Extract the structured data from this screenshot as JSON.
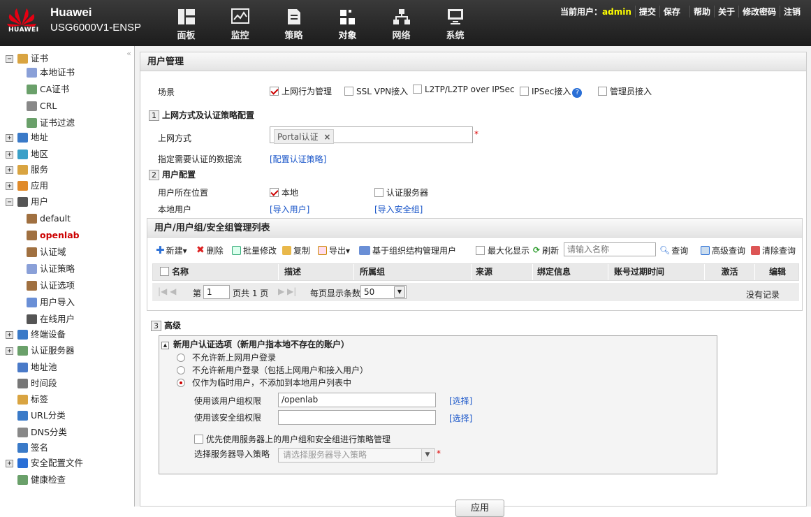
{
  "header": {
    "brand": "Huawei",
    "model": "USG6000V1-ENSP",
    "logo_text": "HUAWEI",
    "nav": [
      {
        "label": "面板",
        "icon": "dashboard-icon"
      },
      {
        "label": "监控",
        "icon": "monitor-icon"
      },
      {
        "label": "策略",
        "icon": "policy-icon"
      },
      {
        "label": "对象",
        "icon": "object-icon"
      },
      {
        "label": "网络",
        "icon": "network-icon"
      },
      {
        "label": "系统",
        "icon": "system-icon"
      }
    ],
    "current_user_label": "当前用户：",
    "current_user": "admin",
    "actions": [
      "提交",
      "保存",
      "帮助",
      "关于",
      "修改密码",
      "注销"
    ]
  },
  "sidebar": {
    "collapse": "«",
    "items": [
      {
        "label": "证书",
        "toggle": "−",
        "icon": "certificate-icon"
      },
      {
        "label": "本地证书",
        "icon": "local-cert-icon"
      },
      {
        "label": "CA证书",
        "icon": "ca-cert-icon"
      },
      {
        "label": "CRL",
        "icon": "crl-icon"
      },
      {
        "label": "证书过滤",
        "icon": "cert-filter-icon"
      },
      {
        "label": "地址",
        "toggle": "+",
        "icon": "address-icon"
      },
      {
        "label": "地区",
        "toggle": "+",
        "icon": "region-icon"
      },
      {
        "label": "服务",
        "toggle": "+",
        "icon": "service-icon"
      },
      {
        "label": "应用",
        "toggle": "+",
        "icon": "application-icon"
      },
      {
        "label": "用户",
        "toggle": "−",
        "icon": "user-icon"
      },
      {
        "label": "default",
        "icon": "user-group-icon"
      },
      {
        "label": "openlab",
        "icon": "user-group-icon"
      },
      {
        "label": "认证域",
        "icon": "auth-domain-icon"
      },
      {
        "label": "认证策略",
        "icon": "auth-policy-icon"
      },
      {
        "label": "认证选项",
        "icon": "auth-option-icon"
      },
      {
        "label": "用户导入",
        "icon": "user-import-icon"
      },
      {
        "label": "在线用户",
        "icon": "online-user-icon"
      },
      {
        "label": "终端设备",
        "toggle": "+",
        "icon": "terminal-icon"
      },
      {
        "label": "认证服务器",
        "toggle": "+",
        "icon": "auth-server-icon"
      },
      {
        "label": "地址池",
        "icon": "address-pool-icon"
      },
      {
        "label": "时间段",
        "icon": "time-range-icon"
      },
      {
        "label": "标签",
        "icon": "tag-icon"
      },
      {
        "label": "URL分类",
        "icon": "url-category-icon"
      },
      {
        "label": "DNS分类",
        "icon": "dns-category-icon"
      },
      {
        "label": "签名",
        "icon": "signature-icon"
      },
      {
        "label": "安全配置文件",
        "toggle": "+",
        "icon": "security-profile-icon"
      },
      {
        "label": "健康检查",
        "icon": "health-check-icon"
      }
    ]
  },
  "main": {
    "title": "用户管理",
    "scene_label": "场景",
    "scenes": [
      {
        "label": "上网行为管理",
        "checked": true
      },
      {
        "label": "SSL VPN接入",
        "checked": false
      },
      {
        "label": "L2TP/L2TP over IPSec",
        "checked": false
      },
      {
        "label": "IPSec接入",
        "checked": false
      },
      {
        "label": "管理员接入",
        "checked": false
      }
    ],
    "help": "?",
    "sec1": {
      "num": "1",
      "title": "上网方式及认证策略配置",
      "mode_label": "上网方式",
      "mode_tag": "Portal认证",
      "tag_close": "×",
      "req": "*",
      "flow_label": "指定需要认证的数据流",
      "flow_link": "[配置认证策略]"
    },
    "sec2": {
      "num": "2",
      "title": "用户配置",
      "loc_label": "用户所在位置",
      "loc_local": "本地",
      "loc_server": "认证服务器",
      "local_label": "本地用户",
      "import_user": "[导入用户]",
      "import_group": "[导入安全组]"
    },
    "list": {
      "title": "用户/用户组/安全组管理列表",
      "toolbar": [
        "新建▾",
        "删除",
        "批量修改",
        "复制",
        "导出▾",
        "基于组织结构管理用户"
      ],
      "maximize": "最大化显示",
      "refresh": "刷新",
      "search_placeholder": "请输入名称",
      "query": "查询",
      "adv_query": "高级查询",
      "clear_query": "清除查询",
      "columns": [
        "名称",
        "描述",
        "所属组",
        "来源",
        "绑定信息",
        "账号过期时间",
        "激活",
        "编辑"
      ],
      "pager": {
        "page_prefix": "第",
        "page": "1",
        "page_suffix": "页共 1 页",
        "per_page_label": "每页显示条数",
        "per_page": "50",
        "no_record": "没有记录"
      }
    },
    "sec3": {
      "num": "3",
      "title": "高级",
      "box_title": "新用户认证选项（新用户指本地不存在的账户）",
      "collapse": "▲",
      "options": [
        {
          "label": "不允许新上网用户登录",
          "checked": false
        },
        {
          "label": "不允许新用户登录（包括上网用户和接入用户）",
          "checked": false
        },
        {
          "label": "仅作为临时用户，不添加到本地用户列表中",
          "checked": true
        }
      ],
      "group_label": "使用该用户组权限",
      "group_value": "/openlab",
      "choose": "[选择]",
      "secgroup_label": "使用该安全组权限",
      "secgroup_value": "",
      "prefer_label": "优先使用服务器上的用户组和安全组进行策略管理",
      "import_policy_label": "选择服务器导入策略",
      "import_policy_placeholder": "请选择服务器导入策略",
      "req": "*"
    },
    "apply": "应用"
  },
  "colors": {
    "accent": "#cc0000",
    "link": "#1a56c9",
    "topbar": "#2a2a2a"
  }
}
